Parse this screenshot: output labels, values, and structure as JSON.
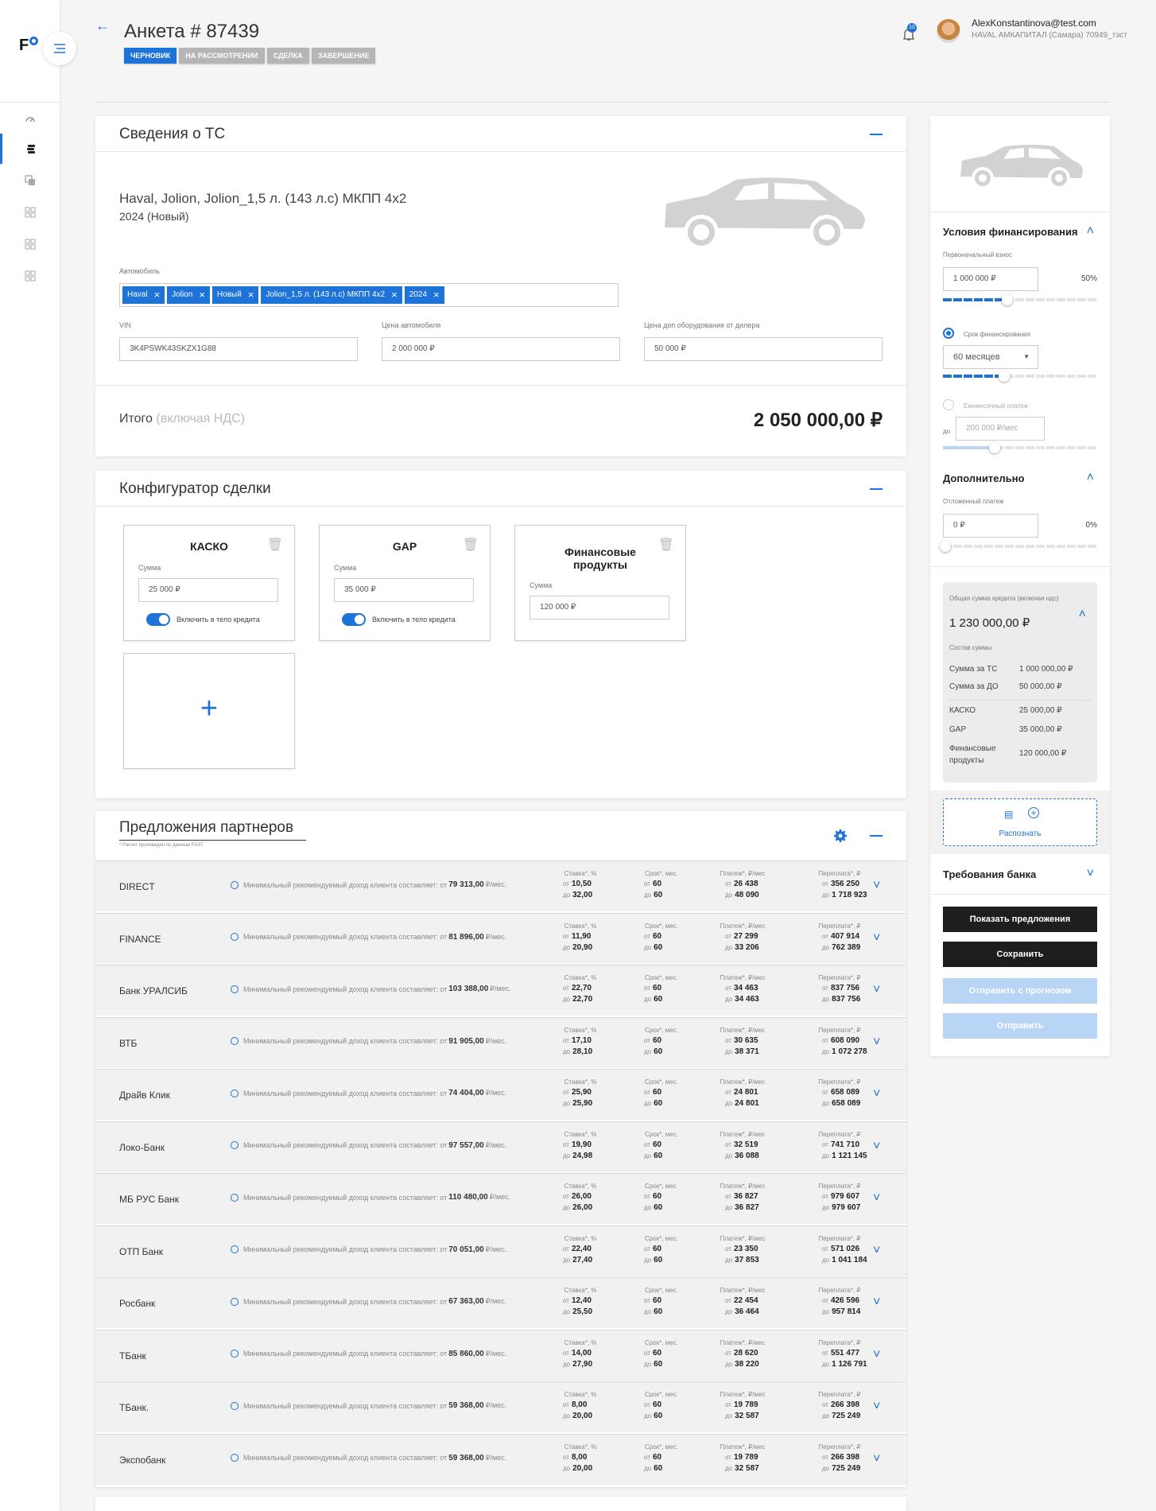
{
  "header": {
    "title": "Анкета # 87439",
    "statuses": [
      "Черновик",
      "На рассмотрении",
      "Сделка",
      "Завершение"
    ],
    "notifications": "10",
    "user_email": "AlexKonstantinova@test.com",
    "user_org": "HAVAL АМКАПИТАЛ (Самара) 70949_тэст"
  },
  "logo": "F",
  "vehicle": {
    "title": "Сведения о ТС",
    "name": "Haval, Jolion, Jolion_1,5 л. (143 л.с) МКПП 4x2",
    "year": "2024 (Новый)",
    "auto_label": "Автомобиль",
    "tags": [
      "Haval",
      "Jolion",
      "Новый",
      "Jolion_1,5 л. (143 л.с) МКПП 4x2",
      "2024"
    ],
    "vin_label": "VIN",
    "vin": "3K4PSWK43SKZX1G88",
    "price_label": "Цена автомобиля",
    "price": "2 000 000 ₽",
    "extra_label": "Цена доп оборудования от дилера",
    "extra": "50 000 ₽",
    "total_label": "Итого",
    "total_note": "(включая НДС)",
    "total": "2 050 000,00 ₽"
  },
  "config": {
    "title": "Конфигуратор сделки",
    "sum_label": "Сумма",
    "toggle_label": "Включить в тело кредита",
    "products": [
      {
        "name": "КАСКО",
        "value": "25 000 ₽"
      },
      {
        "name": "GAP",
        "value": "35 000 ₽"
      },
      {
        "name": "Финансовые продукты",
        "value": "120 000 ₽"
      }
    ],
    "add": "+"
  },
  "partners": {
    "title": "Предложения партнеров",
    "note": "* Расчет произведен по данным FAST",
    "info_text": "Минимальный рекомендуемый доход клиента составляет:",
    "from": "от",
    "to": "до",
    "unit": "₽/мес.",
    "col_rate": "Ставка*, %",
    "col_term": "Срок*, мес.",
    "col_pay": "Платеж*, ₽/мес",
    "col_over": "Переплата*, ₽",
    "rows": [
      {
        "bank": "DIRECT",
        "income": "79 313,00",
        "rate": [
          "10,50",
          "32,00"
        ],
        "term": [
          "60",
          "60"
        ],
        "pay": [
          "26 438",
          "48 090"
        ],
        "over": [
          "356 250",
          "1 718 923"
        ]
      },
      {
        "bank": "FINANCE",
        "income": "81 896,00",
        "rate": [
          "11,90",
          "20,90"
        ],
        "term": [
          "60",
          "60"
        ],
        "pay": [
          "27 299",
          "33 206"
        ],
        "over": [
          "407 914",
          "762 389"
        ]
      },
      {
        "bank": "Банк УРАЛСИБ",
        "income": "103 388,00",
        "rate": [
          "22,70",
          "22,70"
        ],
        "term": [
          "60",
          "60"
        ],
        "pay": [
          "34 463",
          "34 463"
        ],
        "over": [
          "837 756",
          "837 756"
        ]
      },
      {
        "bank": "ВТБ",
        "income": "91 905,00",
        "rate": [
          "17,10",
          "28,10"
        ],
        "term": [
          "60",
          "60"
        ],
        "pay": [
          "30 635",
          "38 371"
        ],
        "over": [
          "608 090",
          "1 072 278"
        ]
      },
      {
        "bank": "Драйв Клик",
        "income": "74 404,00",
        "rate": [
          "25,90",
          "25,90"
        ],
        "term": [
          "60",
          "60"
        ],
        "pay": [
          "24 801",
          "24 801"
        ],
        "over": [
          "658 089",
          "658 089"
        ]
      },
      {
        "bank": "Локо-Банк",
        "income": "97 557,00",
        "rate": [
          "19,90",
          "24,98"
        ],
        "term": [
          "60",
          "60"
        ],
        "pay": [
          "32 519",
          "36 088"
        ],
        "over": [
          "741 710",
          "1 121 145"
        ]
      },
      {
        "bank": "МБ РУС Банк",
        "income": "110 480,00",
        "rate": [
          "26,00",
          "26,00"
        ],
        "term": [
          "60",
          "60"
        ],
        "pay": [
          "36 827",
          "36 827"
        ],
        "over": [
          "979 607",
          "979 607"
        ]
      },
      {
        "bank": "ОТП Банк",
        "income": "70 051,00",
        "rate": [
          "22,40",
          "27,40"
        ],
        "term": [
          "60",
          "60"
        ],
        "pay": [
          "23 350",
          "37 853"
        ],
        "over": [
          "571 026",
          "1 041 184"
        ]
      },
      {
        "bank": "Росбанк",
        "income": "67 363,00",
        "rate": [
          "12,40",
          "25,50"
        ],
        "term": [
          "60",
          "60"
        ],
        "pay": [
          "22 454",
          "36 464"
        ],
        "over": [
          "426 596",
          "957 814"
        ]
      },
      {
        "bank": "ТБанк",
        "income": "85 860,00",
        "rate": [
          "14,00",
          "27,90"
        ],
        "term": [
          "60",
          "60"
        ],
        "pay": [
          "28 620",
          "38 220"
        ],
        "over": [
          "551 477",
          "1 126 791"
        ]
      },
      {
        "bank": "ТБанк.",
        "income": "59 368,00",
        "rate": [
          "8,00",
          "20,00"
        ],
        "term": [
          "60",
          "60"
        ],
        "pay": [
          "19 789",
          "32 587"
        ],
        "over": [
          "266 398",
          "725 249"
        ]
      },
      {
        "bank": "Экспобанк",
        "income": "59 368,00",
        "rate": [
          "8,00",
          "20,00"
        ],
        "term": [
          "60",
          "60"
        ],
        "pay": [
          "19 789",
          "32 587"
        ],
        "over": [
          "266 398",
          "725 249"
        ]
      }
    ]
  },
  "right": {
    "fin_title": "Условия финансирования",
    "down_label": "Первоначальный взнос",
    "down": "1 000 000 ₽",
    "down_pct": "50%",
    "down_level": 0.4,
    "term_label": "Срок финансирования",
    "term": "60 месяцев",
    "term_level": 0.38,
    "monthly_label": "Ежемесячный платеж",
    "to": "до",
    "monthly": "200 000 ₽/мес",
    "monthly_level": 0.32,
    "extra_title": "Дополнительно",
    "deferred_label": "Отложенный платеж",
    "deferred": "0 ₽",
    "deferred_pct": "0%",
    "deferred_level": 0,
    "summary": {
      "label": "Общая сумма кредита (включая ндс)",
      "amount": "1 230 000,00 ₽",
      "breakdown_label": "Состав суммы",
      "items": [
        [
          "Сумма за ТС",
          "1 000 000,00 ₽"
        ],
        [
          "Сумма за ДО",
          "50 000,00 ₽"
        ],
        [
          "КАСКО",
          "25 000,00 ₽"
        ],
        [
          "GAP",
          "35 000,00 ₽"
        ],
        [
          "Финансовые продукты",
          "120 000,00 ₽"
        ]
      ]
    },
    "recognize": "Распознать",
    "bank_req": "Требования банка",
    "btn_show": "Показать предложения",
    "btn_save": "Сохранить",
    "btn_forecast": "Отправить с прогнозом",
    "btn_send": "Отправить"
  }
}
